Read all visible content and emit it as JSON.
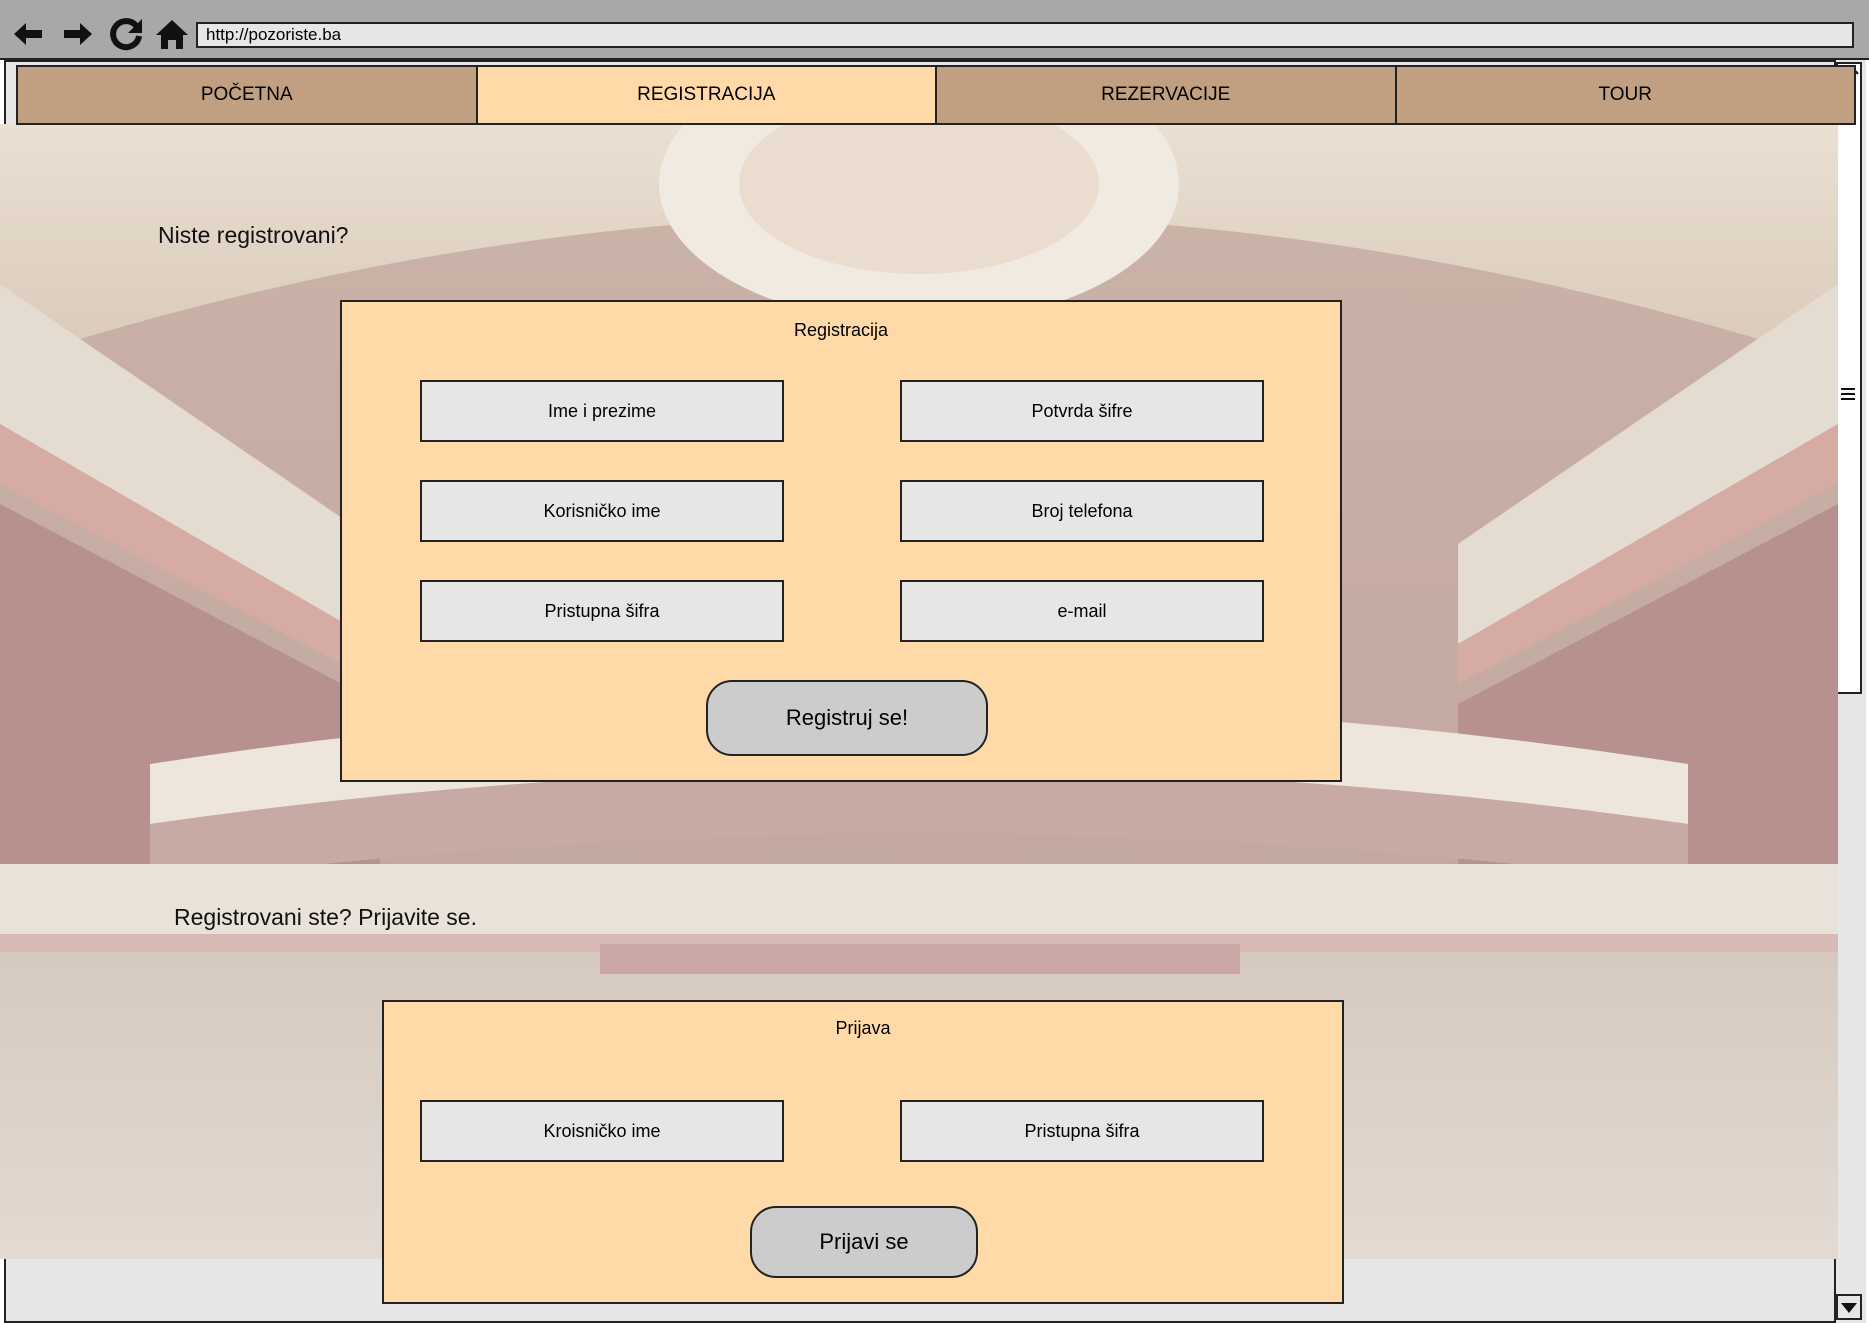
{
  "browser": {
    "url": "http://pozoriste.ba",
    "icons": [
      "back-arrow-icon",
      "forward-arrow-icon",
      "refresh-icon",
      "home-icon"
    ]
  },
  "tabs": [
    {
      "label": "POČETNA",
      "active": false
    },
    {
      "label": "REGISTRACIJA",
      "active": true
    },
    {
      "label": "REZERVACIJE",
      "active": false
    },
    {
      "label": "TOUR",
      "active": false
    }
  ],
  "register_section": {
    "question": "Niste registrovani?",
    "panel_title": "Registracija",
    "fields_left": [
      "Ime i prezime",
      "Korisničko ime",
      "Pristupna šifra"
    ],
    "fields_right": [
      "Potvrda šifre",
      "Broj telefona",
      "e-mail"
    ],
    "button": "Registruj se!"
  },
  "login_section": {
    "question": "Registrovani ste? Prijavite se.",
    "panel_title": "Prijava",
    "fields": [
      "Kroisničko ime",
      "Pristupna šifra"
    ],
    "button": "Prijavi  se"
  },
  "colors": {
    "tab_bg": "#c0a080",
    "tab_active_bg": "#ffdaa8",
    "panel_bg": "#ffdaa8",
    "field_bg": "#e6e6e6",
    "button_bg": "#cccccc",
    "chrome_bg": "#a8a8a8"
  }
}
